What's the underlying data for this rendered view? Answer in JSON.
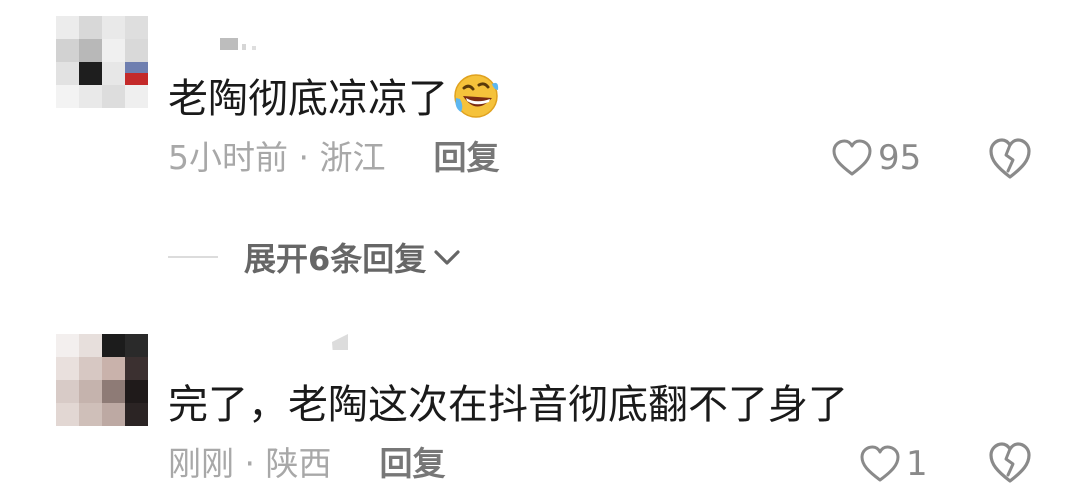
{
  "comments": [
    {
      "text": "老陶彻底凉凉了",
      "emoji_icon": "rolling-laughing-emoji",
      "time_location": "5小时前 · 浙江",
      "reply_label": "回复",
      "likes": "95",
      "expand_label": "展开6条回复"
    },
    {
      "text": "完了，老陶这次在抖音彻底翻不了身了",
      "time_location": "刚刚 · 陕西",
      "reply_label": "回复",
      "likes": "1"
    }
  ],
  "icons": {
    "like": "heart-outline-icon",
    "dislike": "broken-heart-icon",
    "expand": "chevron-down-icon"
  },
  "colors": {
    "text": "#1a1a1a",
    "meta": "#a8a8a8",
    "reply": "#777777",
    "icon": "#8a8a8a"
  }
}
